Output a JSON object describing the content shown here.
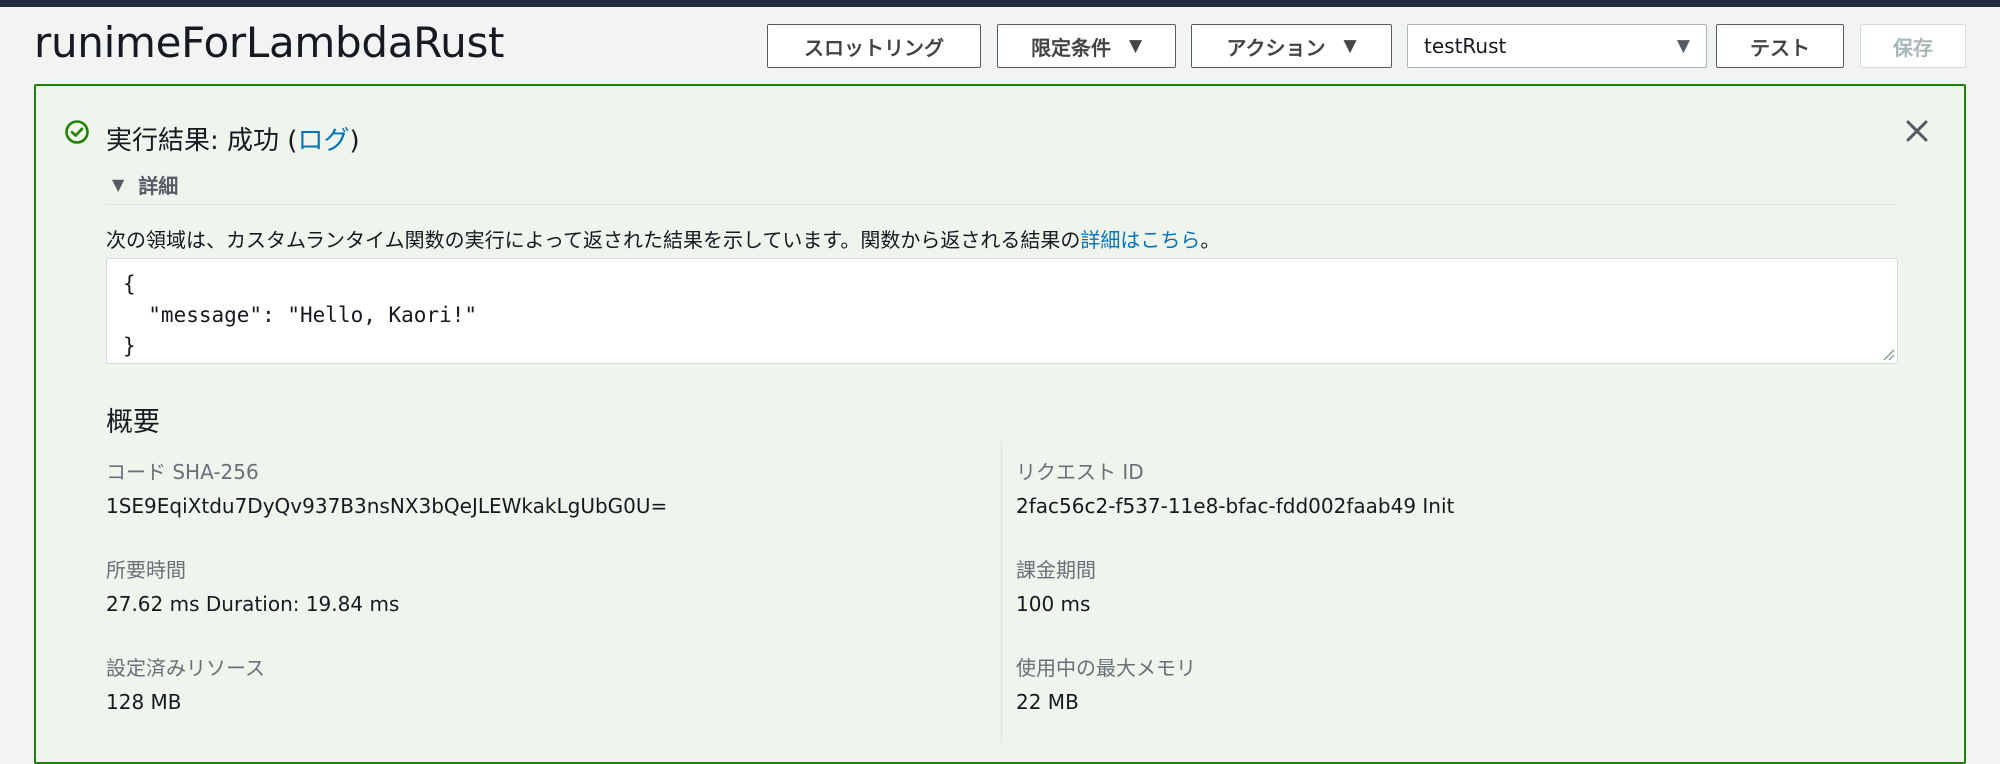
{
  "header": {
    "function_name": "runimeForLambdaRust",
    "buttons": {
      "throttling": "スロットリング",
      "qualifiers": "限定条件",
      "actions": "アクション",
      "test": "テスト",
      "save": "保存"
    },
    "test_event_select": {
      "value": "testRust"
    }
  },
  "result": {
    "title_prefix": "実行結果: 成功 (",
    "log_link": "ログ",
    "title_suffix": ")",
    "details_label": "詳細",
    "description": "次の領域は、カスタムランタイム関数の実行によって返された結果を示しています。関数から返される結果の",
    "details_link": "詳細はこちら",
    "description_suffix": "。",
    "output": "{\n  \"message\": \"Hello, Kaori!\"\n}"
  },
  "summary": {
    "title": "概要",
    "fields": {
      "code_sha_label": "コード SHA-256",
      "code_sha_value": "1SE9EqiXtdu7DyQv937B3nsNX3bQeJLEWkakLgUbG0U=",
      "request_id_label": "リクエスト ID",
      "request_id_value": "2fac56c2-f537-11e8-bfac-fdd002faab49 Init",
      "duration_label": "所要時間",
      "duration_value": "27.62 ms Duration: 19.84 ms",
      "billed_label": "課金期間",
      "billed_value": "100 ms",
      "resources_label": "設定済みリソース",
      "resources_value": "128 MB",
      "max_memory_label": "使用中の最大メモリ",
      "max_memory_value": "22 MB"
    }
  },
  "colors": {
    "success": "#1d8102",
    "link": "#0073bb",
    "panel_bg": "#eff5ec"
  },
  "icons": {
    "success": "check-circle-icon",
    "close": "close-icon",
    "caret": "caret-down-icon"
  }
}
